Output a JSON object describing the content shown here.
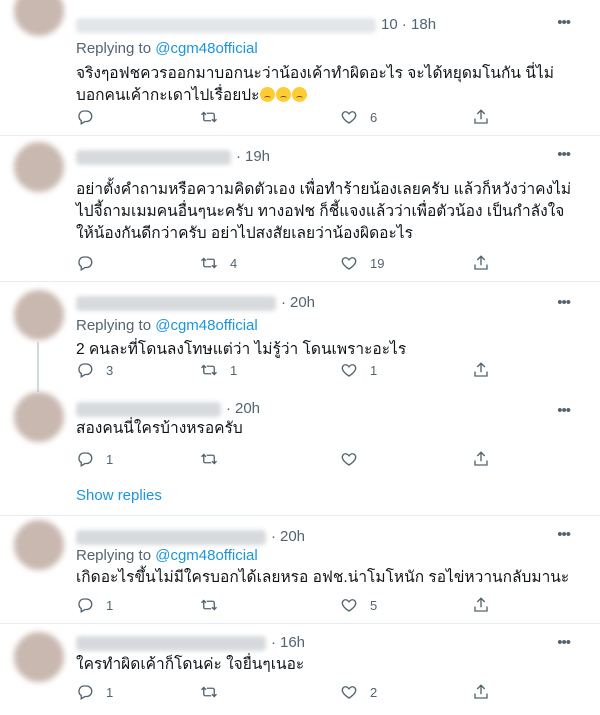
{
  "tweets": [
    {
      "time": "10 · 18h",
      "replying_prefix": "Replying to",
      "replying_handle": "@cgm48official",
      "text": "จริงๆอฟชควรออกมาบอกนะว่าน้องเค้าทำผิดอะไร จะได้หยุดมโนกัน นี่ไม่บอกคนเค้ากะเดาไปเรื่อยปะ",
      "emoji_count": 3,
      "reply_count": "",
      "retweet_count": "",
      "like_count": "6",
      "more_icon": "more-dots-icon"
    },
    {
      "time": "19h",
      "replying_prefix": "",
      "replying_handle": "",
      "text": "อย่าตั้งคำถามหรือความคิดตัวเอง เพื่อทำร้ายน้องเลยครับ แล้วก็หวังว่าคงไม่ไปจี้ถามเมมคนอื่นๆนะครับ ทางอฟช ก็ชี้แจงแล้วว่าเพื่อตัวน้อง เป็นกำลังใจให้น้องกันดีกว่าครับ อย่าไปสงสัยเลยว่าน้องผิดอะไร",
      "reply_count": "",
      "retweet_count": "4",
      "like_count": "19"
    },
    {
      "time": "20h",
      "replying_prefix": "Replying to",
      "replying_handle": "@cgm48official",
      "text": "2 คนละที่โดนลงโทษแต่ว่า ไม่รู้ว่า โดนเพราะอะไร",
      "reply_count": "3",
      "retweet_count": "1",
      "like_count": "1"
    },
    {
      "time": "20h",
      "replying_prefix": "",
      "replying_handle": "",
      "text": "สองคนนี่ใครบ้างหรอครับ",
      "reply_count": "1",
      "retweet_count": "",
      "like_count": ""
    },
    {
      "time": "20h",
      "replying_prefix": "Replying to",
      "replying_handle": "@cgm48official",
      "text": "เกิดอะไรขึ้นไม่มีใครบอกได้เลยหรอ อฟช.น่าโมโหนัก รอไข่หวานกลับมานะ",
      "reply_count": "1",
      "retweet_count": "",
      "like_count": "5"
    },
    {
      "time": "16h",
      "replying_prefix": "",
      "replying_handle": "",
      "text": "ใครทำผิดเค้าก็โดนค่ะ ใจยื่นๆเนอะ",
      "reply_count": "1",
      "retweet_count": "",
      "like_count": "2"
    }
  ],
  "show_replies": "Show replies",
  "colors": {
    "link": "#1b95e0",
    "muted": "#536471",
    "text": "#0f1419",
    "border": "#e6ecf0"
  }
}
